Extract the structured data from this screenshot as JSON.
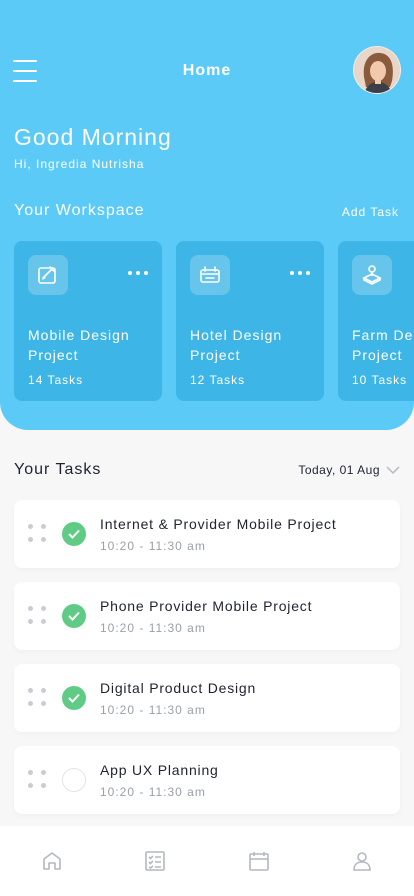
{
  "header": {
    "title": "Home",
    "menu_icon": "hamburger-menu-icon",
    "avatar_icon": "user-avatar"
  },
  "greeting": {
    "title": "Good Morning",
    "subtitle": "Hi, Ingredia Nutrisha"
  },
  "workspace": {
    "title": "Your Workspace",
    "add_task": "Add Task",
    "cards": [
      {
        "name": "Mobile Design Project",
        "count": "14 Tasks",
        "icon": "design-edit-icon"
      },
      {
        "name": "Hotel Design Project",
        "count": "12 Tasks",
        "icon": "hotel-icon"
      },
      {
        "name": "Farm Design Project",
        "count": "10 Tasks",
        "icon": "joystick-icon"
      }
    ]
  },
  "tasks": {
    "title": "Your Tasks",
    "date": "Today, 01 Aug",
    "items": [
      {
        "name": "Internet & Provider Mobile Project",
        "time": "10:20 - 11:30 am",
        "done": true
      },
      {
        "name": "Phone Provider Mobile Project",
        "time": "10:20 - 11:30 am",
        "done": true
      },
      {
        "name": "Digital Product Design",
        "time": "10:20 - 11:30 am",
        "done": true
      },
      {
        "name": "App UX Planning",
        "time": "10:20 - 11:30 am",
        "done": false
      }
    ]
  },
  "tabbar": {
    "items": [
      {
        "icon": "home-icon"
      },
      {
        "icon": "checklist-icon"
      },
      {
        "icon": "calendar-icon"
      },
      {
        "icon": "profile-icon"
      }
    ]
  },
  "colors": {
    "header_bg": "#5ccaf7",
    "card_bg": "#3db5e6",
    "check_done": "#5fcb85",
    "tab_icon": "#b4b8c0"
  }
}
